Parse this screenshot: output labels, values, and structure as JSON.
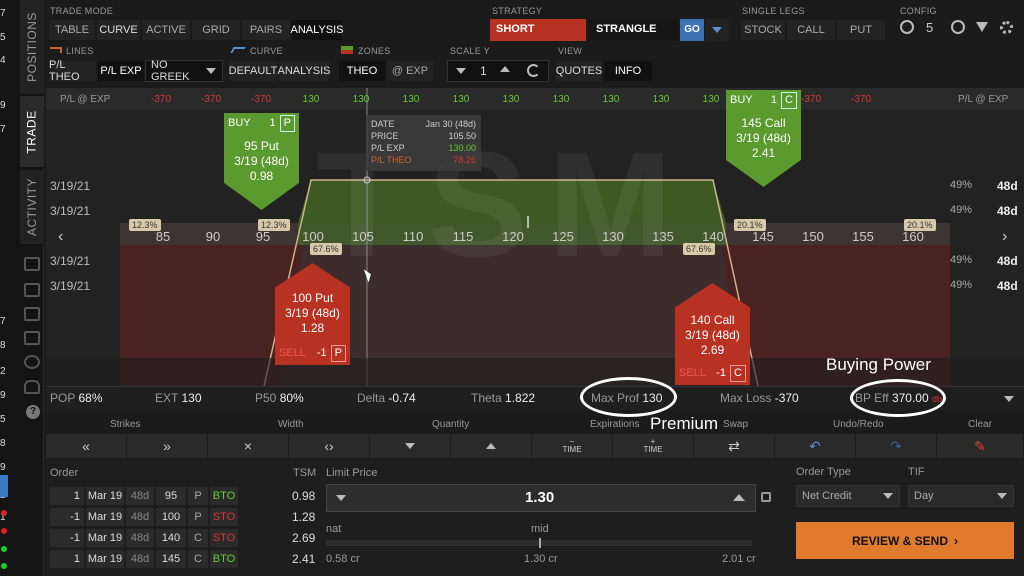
{
  "rail": {
    "edge_numbers": [
      "7",
      "5",
      "4",
      "",
      "9",
      "7",
      "",
      "",
      "",
      "",
      "",
      "",
      "",
      "7",
      "8",
      "2",
      "9",
      "5",
      "8",
      "9",
      "2",
      "1"
    ],
    "tabs": [
      "POSITIONS",
      "TRADE",
      "ACTIVITY"
    ]
  },
  "toolbar": {
    "trade_mode_label": "TRADE MODE",
    "trade_modes": [
      "TABLE",
      "CURVE",
      "ACTIVE",
      "GRID",
      "PAIRS",
      "ANALYSIS"
    ],
    "strategy_label": "STRATEGY",
    "side": "SHORT",
    "strategy": "STRANGLE",
    "go_label": "GO",
    "single_legs_label": "SINGLE LEGS",
    "single_legs": [
      "STOCK",
      "CALL",
      "PUT"
    ],
    "config_label": "CONFIG",
    "config_value": "5",
    "lines_label": "LINES",
    "lines": [
      "P/L THEO",
      "P/L EXP"
    ],
    "greek_select": "NO GREEK",
    "curve_label": "CURVE",
    "curves": [
      "DEFAULT",
      "ANALYSIS"
    ],
    "zones_label": "ZONES",
    "zones": [
      "THEO",
      "@ EXP"
    ],
    "scale_label": "SCALE Y",
    "scale_value": "1",
    "view_label": "VIEW",
    "views": [
      "QUOTES",
      "INFO"
    ]
  },
  "plot": {
    "pl_label_left": "P/L @ EXP",
    "pl_label_right": "P/L @ EXP",
    "pl_values": [
      "-370",
      "-370",
      "-370",
      "130",
      "130",
      "130",
      "130",
      "130",
      "130",
      "130",
      "130",
      "130",
      "-370",
      "-370",
      "-370"
    ],
    "strikes": [
      "85",
      "90",
      "95",
      "100",
      "105",
      "110",
      "115",
      "120",
      "125",
      "130",
      "135",
      "140",
      "145",
      "150",
      "155",
      "160"
    ],
    "dates": [
      "3/19/21",
      "3/19/21",
      "3/19/21",
      "3/19/21"
    ],
    "right_pct": [
      "49%",
      "49%",
      "49%",
      "49%"
    ],
    "right_dte": [
      "48d",
      "48d",
      "48d",
      "48d"
    ],
    "badges_top": [
      "12.3%",
      "12.3%",
      "20.1%",
      "20.1%"
    ],
    "badges_mid": [
      "67.6%",
      "67.6%"
    ],
    "watermark": "TSM",
    "info": {
      "date_label": "DATE",
      "date_value": "Jan 30 (48d)",
      "price_label": "PRICE",
      "price_value": "105.50",
      "plexp_label": "P/L EXP",
      "plexp_value": "130.00",
      "pltheo_label": "P/L THEO",
      "pltheo_value": "78.26"
    },
    "legs": [
      {
        "action": "BUY",
        "qty": "1",
        "type": "P",
        "line1": "95 Put",
        "line2": "3/19 (48d)",
        "line3": "0.98"
      },
      {
        "action": "BUY",
        "qty": "1",
        "type": "C",
        "line1": "145 Call",
        "line2": "3/19 (48d)",
        "line3": "2.41"
      },
      {
        "action": "SELL",
        "qty": "-1",
        "type": "P",
        "line1": "100 Put",
        "line2": "3/19 (48d)",
        "line3": "1.28"
      },
      {
        "action": "SELL",
        "qty": "-1",
        "type": "C",
        "line1": "140 Call",
        "line2": "3/19 (48d)",
        "line3": "2.69"
      }
    ]
  },
  "stats": {
    "pop_label": "POP",
    "pop": "68%",
    "ext_label": "EXT",
    "ext": "130",
    "p50_label": "P50",
    "p50": "80%",
    "delta_label": "Delta",
    "delta": "-0.74",
    "theta_label": "Theta",
    "theta": "1.822",
    "maxprof_label": "Max Prof",
    "maxprof": "130",
    "maxloss_label": "Max Loss",
    "maxloss": "-370",
    "bp_label": "BP Eff",
    "bp": "370.00",
    "bp_unit": "db"
  },
  "annotations": {
    "buying_power": "Buying Power",
    "premium": "Premium"
  },
  "controls": {
    "labels": [
      "Strikes",
      "Width",
      "Quantity",
      "Expirations",
      "Swap",
      "Undo/Redo",
      "Clear"
    ],
    "time_label": "TIME"
  },
  "order": {
    "order_label": "Order",
    "tsm_label": "TSM",
    "rows": [
      {
        "qty": "1",
        "exp": "Mar 19",
        "dte": "48d",
        "strike": "95",
        "type": "P",
        "tag": "BTO",
        "price": "0.98"
      },
      {
        "qty": "-1",
        "exp": "Mar 19",
        "dte": "48d",
        "strike": "100",
        "type": "P",
        "tag": "STO",
        "price": "1.28"
      },
      {
        "qty": "-1",
        "exp": "Mar 19",
        "dte": "48d",
        "strike": "140",
        "type": "C",
        "tag": "STO",
        "price": "2.69"
      },
      {
        "qty": "1",
        "exp": "Mar 19",
        "dte": "48d",
        "strike": "145",
        "type": "C",
        "tag": "BTO",
        "price": "2.41"
      }
    ],
    "limit_label": "Limit Price",
    "limit_value": "1.30",
    "nat_label": "nat",
    "mid_label": "mid",
    "nat_value": "0.58 cr",
    "mid_value": "1.30 cr",
    "far_value": "2.01 cr",
    "order_type_label": "Order Type",
    "order_type": "Net Credit",
    "tif_label": "TIF",
    "tif": "Day",
    "submit": "REVIEW & SEND"
  },
  "colors": {
    "green": "#5a9a2e",
    "red": "#b83224",
    "orange": "#e07b2e",
    "blue": "#2a6fb0"
  }
}
